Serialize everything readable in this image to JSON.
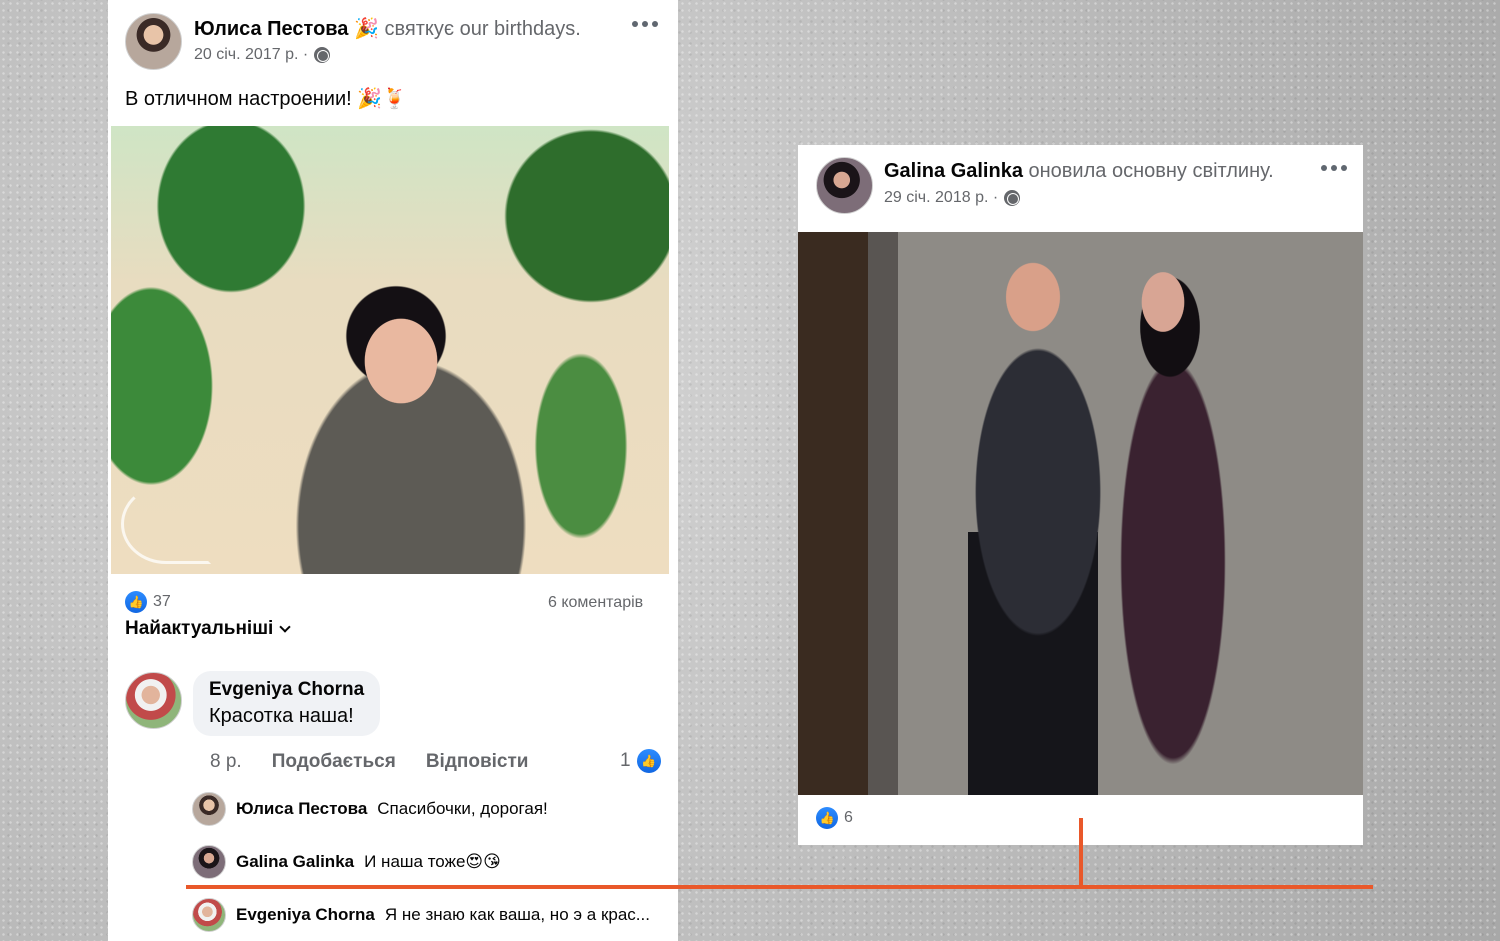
{
  "left_post": {
    "author": "Юлиса Пестова",
    "action_emoji": "🎉",
    "action_text": "святкує our birthdays.",
    "date": "20 січ. 2017 р. ·",
    "text": "В отличном настроении! 🎉🍹",
    "likes": "37",
    "comments_count": "6 коментарів",
    "sort_label": "Найактуальніші",
    "comment": {
      "author": "Evgeniya Chorna",
      "text": "Красотка наша!",
      "time": "8 р.",
      "like_label": "Подобається",
      "reply_label": "Відповісти",
      "like_count": "1"
    },
    "replies": [
      {
        "author": "Юлиса Пестова",
        "text": "Спасибочки, дорогая!"
      },
      {
        "author": "Galina Galinka",
        "text": "И наша тоже😍😘"
      },
      {
        "author": "Evgeniya Chorna",
        "text": "Я не знаю как ваша, но э а крас..."
      }
    ]
  },
  "right_post": {
    "author": "Galina Galinka",
    "action_text": "оновила основну світлину.",
    "date": "29 січ. 2018 р. ·",
    "likes": "6"
  },
  "colors": {
    "connector": "#e9582a",
    "like_blue": "#1877f2"
  },
  "icons": {
    "globe": "globe-icon",
    "more": "more-options-icon",
    "like": "like-icon",
    "chevron": "chevron-down-icon"
  }
}
